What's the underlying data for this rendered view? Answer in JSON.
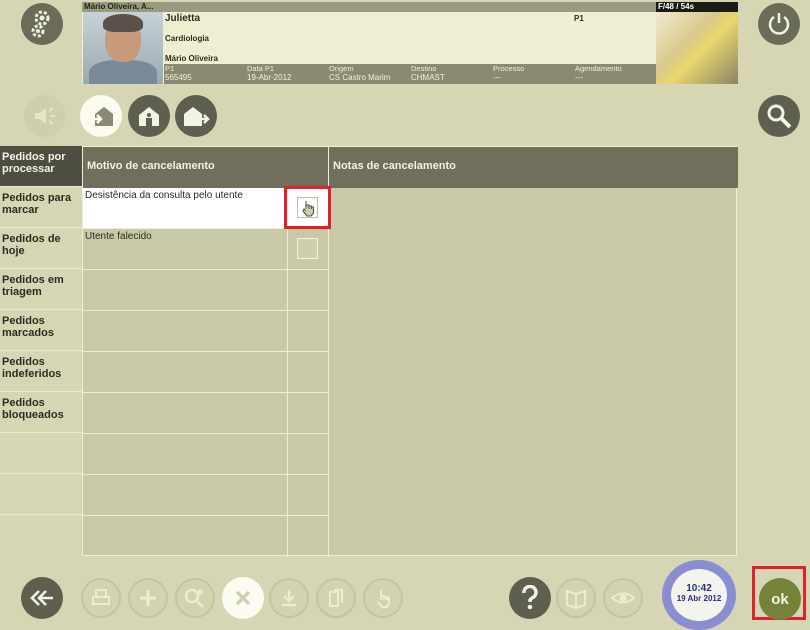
{
  "header": {
    "top_name": "Mário Oliveira, A...",
    "patient_name": "Julietta",
    "specialty": "Cardiologia",
    "doctor": "Mário Oliveira",
    "p1_top": "P1",
    "timer": "F/48 / 54s",
    "info": [
      {
        "label": "P1",
        "value": "565495"
      },
      {
        "label": "Data P1",
        "value": "19-Abr-2012"
      },
      {
        "label": "Origem",
        "value": "CS Castro Marim"
      },
      {
        "label": "Destino",
        "value": "CHMAST"
      },
      {
        "label": "Processo",
        "value": "---"
      },
      {
        "label": "Agendamento",
        "value": "---"
      }
    ]
  },
  "sidebar": {
    "items": [
      {
        "label": "Pedidos por processar"
      },
      {
        "label": "Pedidos para marcar"
      },
      {
        "label": "Pedidos de hoje"
      },
      {
        "label": "Pedidos em triagem"
      },
      {
        "label": "Pedidos marcados"
      },
      {
        "label": "Pedidos indeferidos"
      },
      {
        "label": "Pedidos bloqueados"
      }
    ]
  },
  "table": {
    "col_reason": "Motivo de cancelamento",
    "col_notes": "Notas de cancelamento",
    "rows": [
      {
        "reason": "Desistência da consulta pelo utente",
        "checked": true
      },
      {
        "reason": "Utente falecido",
        "checked": false
      }
    ]
  },
  "clock": {
    "time": "10:42",
    "date": "19 Abr 2012"
  },
  "ok": {
    "label": "ok"
  },
  "colors": {
    "highlight": "#e0202a",
    "accent": "#75823a",
    "dark": "#5f5f50"
  }
}
